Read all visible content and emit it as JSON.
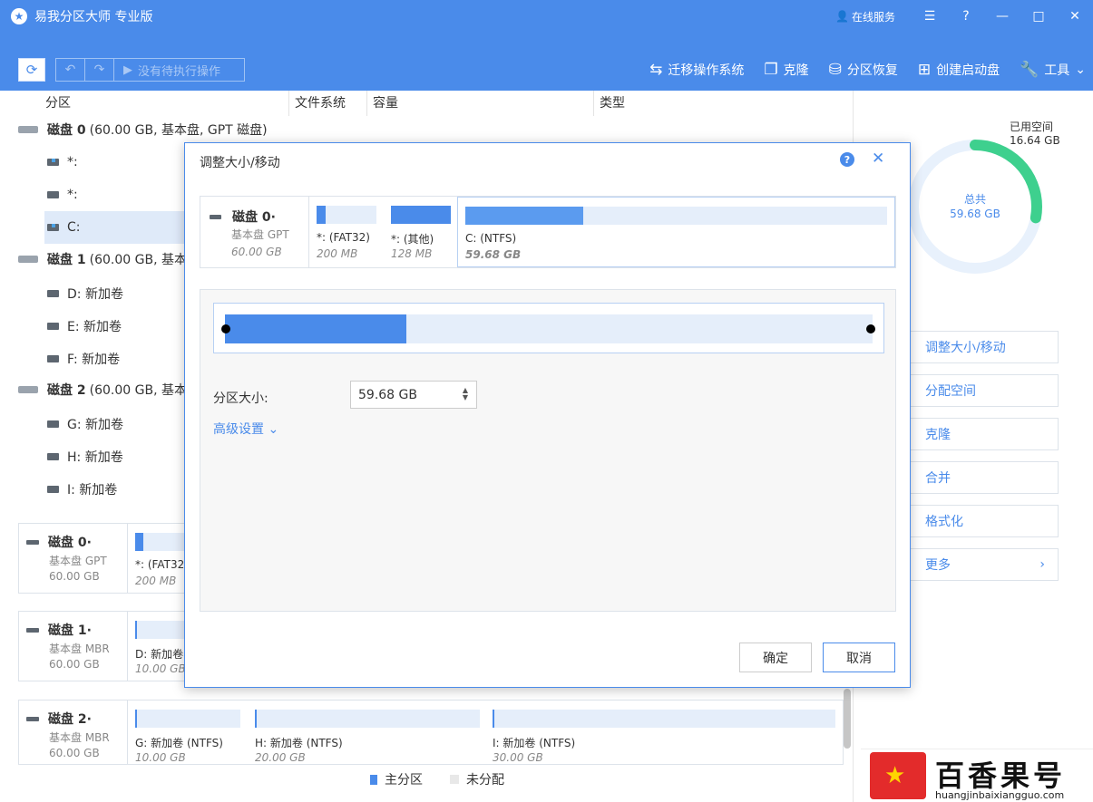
{
  "app": {
    "title": "易我分区大师 专业版",
    "online_service": "在线服务"
  },
  "toolbar": {
    "pending_label": "没有待执行操作",
    "actions": [
      {
        "label": "迁移操作系统",
        "icon": "migrate-icon"
      },
      {
        "label": "克隆",
        "icon": "clone-icon"
      },
      {
        "label": "分区恢复",
        "icon": "recovery-icon"
      },
      {
        "label": "创建启动盘",
        "icon": "bootdisk-icon"
      },
      {
        "label": "工具",
        "icon": "wrench-icon"
      }
    ]
  },
  "table": {
    "headers": [
      "分区",
      "文件系统",
      "容量",
      "类型"
    ]
  },
  "tree": {
    "disk0": {
      "name": "磁盘 0",
      "info": "(60.00 GB, 基本盘, GPT 磁盘)"
    },
    "disk0_parts": [
      "*:",
      "*:",
      "C:"
    ],
    "disk1": {
      "name": "磁盘 1",
      "info": "(60.00 GB, 基本盘"
    },
    "disk1_parts": [
      "D: 新加卷",
      "E: 新加卷",
      "F: 新加卷"
    ],
    "disk2": {
      "name": "磁盘 2",
      "info": "(60.00 GB, 基本盘"
    },
    "disk2_parts": [
      "G: 新加卷",
      "H: 新加卷",
      "I: 新加卷"
    ]
  },
  "cards": [
    {
      "name": "磁盘 0·",
      "type": "基本盘 GPT",
      "size": "60.00 GB",
      "parts": [
        {
          "label": "*:  (FAT32",
          "size": "200 MB"
        }
      ]
    },
    {
      "name": "磁盘 1·",
      "type": "基本盘 MBR",
      "size": "60.00 GB",
      "parts": [
        {
          "label": "D: 新加卷",
          "size": "10.00 GB"
        }
      ]
    },
    {
      "name": "磁盘 2·",
      "type": "基本盘 MBR",
      "size": "60.00 GB",
      "parts": [
        {
          "label": "G: 新加卷 (NTFS)",
          "size": "10.00 GB"
        },
        {
          "label": "H: 新加卷 (NTFS)",
          "size": "20.00 GB"
        },
        {
          "label": "I: 新加卷 (NTFS)",
          "size": "30.00 GB"
        }
      ]
    }
  ],
  "legend": {
    "primary": "主分区",
    "unallocated": "未分配"
  },
  "right": {
    "used_label": "已用空间",
    "used_value": "16.64 GB",
    "total_label": "总共",
    "total_value": "59.68 GB",
    "used_fraction": 0.279,
    "ops": [
      "调整大小/移动",
      "分配空间",
      "克隆",
      "合并",
      "格式化",
      "更多"
    ]
  },
  "dialog": {
    "title": "调整大小/移动",
    "disk_name": "磁盘 0·",
    "disk_type": "基本盘 GPT",
    "disk_size": "60.00 GB",
    "parts": [
      {
        "label": "*:  (FAT32)",
        "size": "200 MB"
      },
      {
        "label": "*:  (其他)",
        "size": "128 MB"
      },
      {
        "label": "C:  (NTFS)",
        "size": "59.68 GB"
      }
    ],
    "size_label": "分区大小:",
    "size_value": "59.68 GB",
    "advanced": "高级设置",
    "ok": "确定",
    "cancel": "取消"
  },
  "watermark": {
    "title": "百香果号",
    "url": "huangjinbaixiangguo.com"
  }
}
